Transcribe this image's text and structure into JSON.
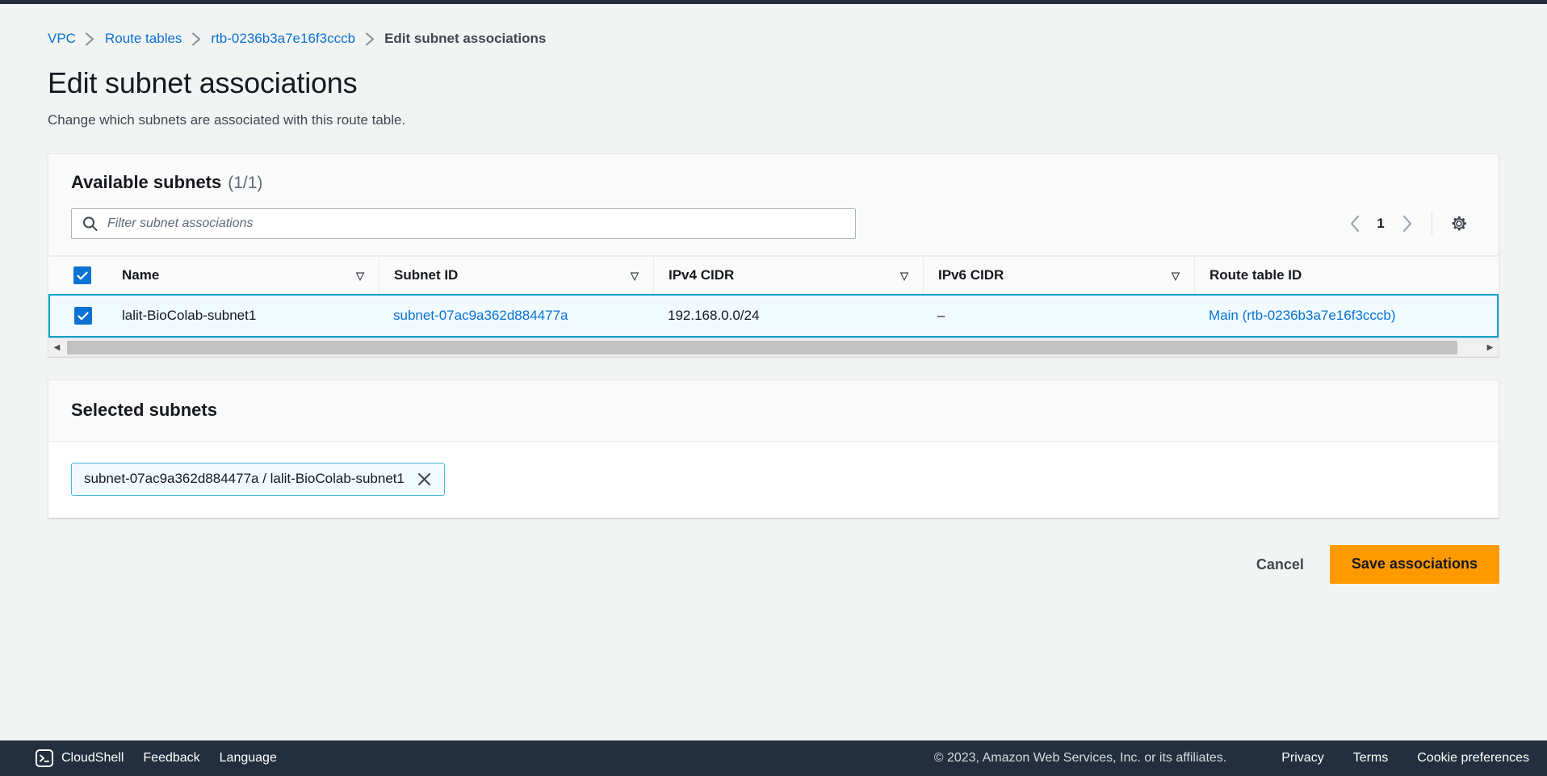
{
  "breadcrumb": {
    "items": [
      {
        "label": "VPC",
        "current": false
      },
      {
        "label": "Route tables",
        "current": false
      },
      {
        "label": "rtb-0236b3a7e16f3cccb",
        "current": false
      },
      {
        "label": "Edit subnet associations",
        "current": true
      }
    ]
  },
  "header": {
    "title": "Edit subnet associations",
    "description": "Change which subnets are associated with this route table."
  },
  "available_subnets": {
    "title": "Available subnets",
    "counter": "(1/1)",
    "filter": {
      "placeholder": "Filter subnet associations",
      "value": ""
    },
    "pagination": {
      "current_page": "1",
      "prev_label": "‹",
      "next_label": "›"
    },
    "columns": [
      {
        "label": "Name",
        "sortable": true
      },
      {
        "label": "Subnet ID",
        "sortable": true
      },
      {
        "label": "IPv4 CIDR",
        "sortable": true
      },
      {
        "label": "IPv6 CIDR",
        "sortable": true
      },
      {
        "label": "Route table ID",
        "sortable": false
      }
    ],
    "rows": [
      {
        "selected": true,
        "name": "lalit-BioColab-subnet1",
        "subnet_id": "subnet-07ac9a362d884477a",
        "ipv4_cidr": "192.168.0.0/24",
        "ipv6_cidr": "–",
        "route_table_id": "Main (rtb-0236b3a7e16f3cccb)"
      }
    ]
  },
  "selected_subnets": {
    "title": "Selected subnets",
    "tokens": [
      {
        "label": "subnet-07ac9a362d884477a / lalit-BioColab-subnet1"
      }
    ]
  },
  "actions": {
    "cancel_label": "Cancel",
    "save_label": "Save associations"
  },
  "footer": {
    "cloudshell_label": "CloudShell",
    "feedback_label": "Feedback",
    "language_label": "Language",
    "copyright": "© 2023, Amazon Web Services, Inc. or its affiliates.",
    "privacy_label": "Privacy",
    "terms_label": "Terms",
    "cookie_label": "Cookie preferences"
  },
  "colors": {
    "accent_link": "#0972d3",
    "primary_button": "#ff9900",
    "selection_border": "#00a1c9",
    "selection_fill": "#f1faff",
    "footer_bg": "#232f3e",
    "page_bg": "#f2f3f3"
  }
}
